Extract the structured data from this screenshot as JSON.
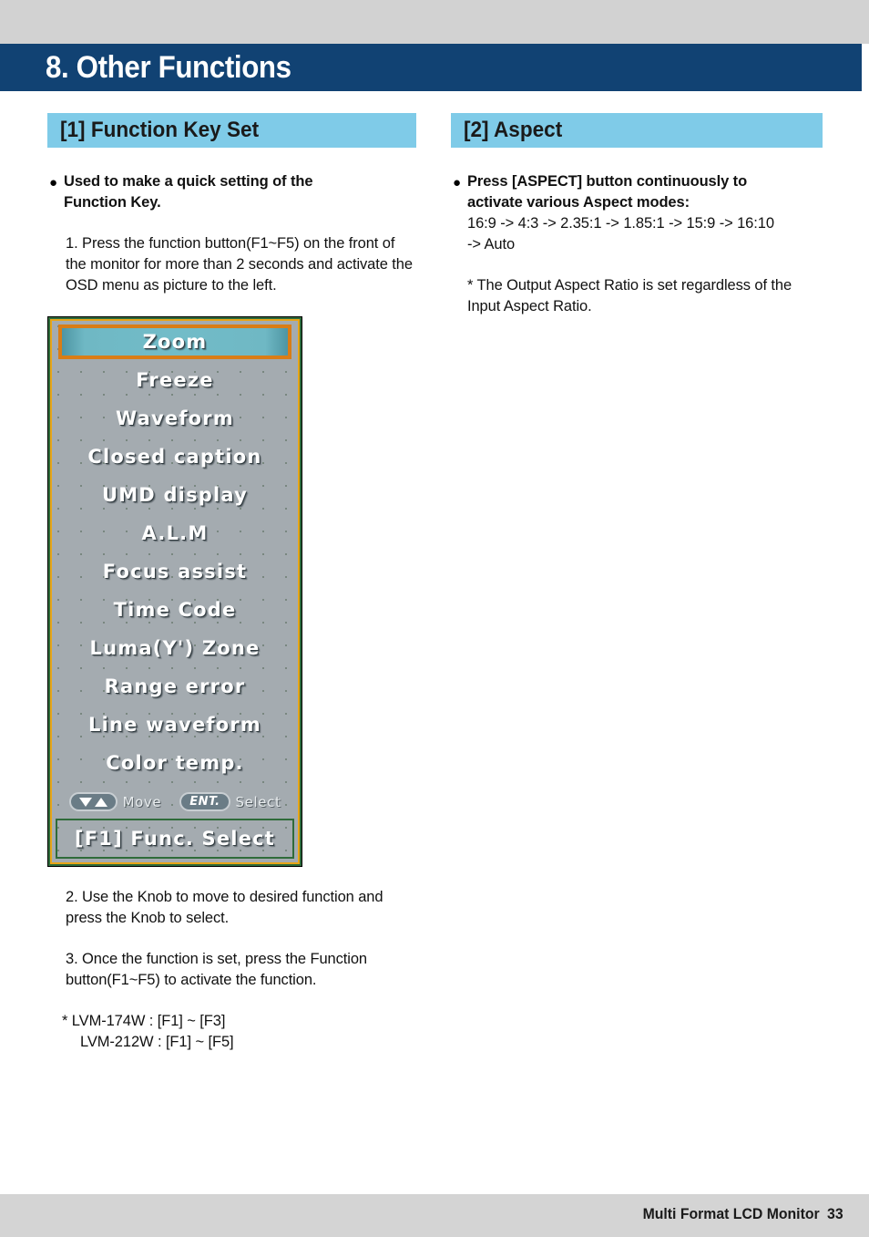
{
  "page": {
    "chapter_title": "8. Other Functions",
    "footer_label": "Multi Format LCD Monitor",
    "footer_page": "33",
    "accent_dark_blue": "#114273",
    "accent_light_blue": "#7fcbe8",
    "band_gray": "#d2d2d2"
  },
  "left_column": {
    "section_title": "[1] Function Key Set",
    "bullet": "Used to make a quick setting of the\nFunction Key.",
    "bullet_line1": "Used to make a quick setting of the",
    "bullet_line2": "Function Key.",
    "step1": "1. Press the function button(F1~F5) on the front of the monitor for more than 2 seconds and activate the OSD menu as picture to the left.",
    "step2": "2. Use the Knob to move to desired function and press the Knob to select.",
    "step3": "3. Once the function is set, press the Function button(F1~F5) to activate the function.",
    "note_line1": "* LVM-174W : [F1] ~ [F3]",
    "note_line2": "LVM-212W : [F1] ~ [F5]"
  },
  "right_column": {
    "section_title": "[2] Aspect",
    "bullet_line1": "Press [ASPECT] button continuously to",
    "bullet_line2": "activate various Aspect modes:",
    "modes_line1": "16:9 -> 4:3 -> 2.35:1 -> 1.85:1 -> 15:9 -> 16:10",
    "modes_line2": "-> Auto",
    "note": "* The Output Aspect Ratio is set regardless of the Input Aspect Ratio."
  },
  "osd": {
    "selected_index": 0,
    "items": [
      "Zoom",
      "Freeze",
      "Waveform",
      "Closed caption",
      "UMD display",
      "A.L.M",
      "Focus assist",
      "Time Code",
      "Luma(Y') Zone",
      "Range error",
      "Line waveform",
      "Color temp."
    ],
    "hint_move_label": "Move",
    "hint_select_label": "Select",
    "hint_ent_label": "ENT.",
    "footer_label": "[F1] Func. Select",
    "colors": {
      "screen_gray": "#a4abb0",
      "highlight_teal": "#72bcc8",
      "highlight_border_orange": "#d97d16",
      "frame_gold": "#e8a517",
      "frame_green": "#2f6b3a"
    }
  }
}
